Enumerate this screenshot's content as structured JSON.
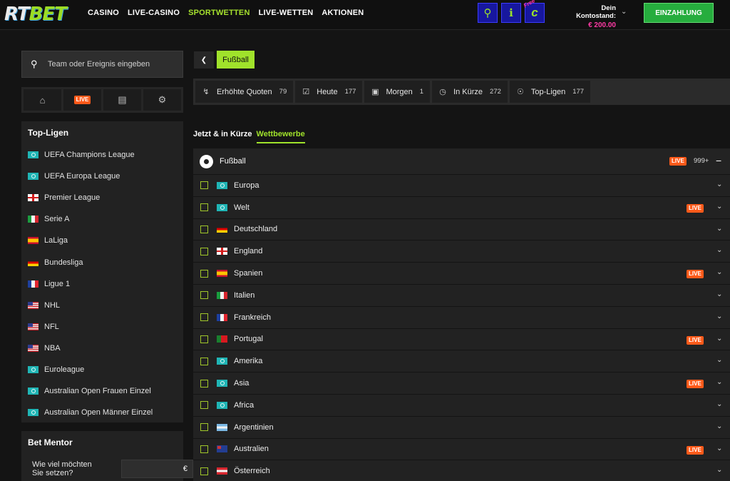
{
  "header": {
    "logo_a": "RT",
    "logo_b": "BET",
    "nav": [
      "CASINO",
      "LIVE-CASINO",
      "SPORTWETTEN",
      "LIVE-WETTEN",
      "AKTIONEN"
    ],
    "free_tag": "Free",
    "balance_label": "Dein Kontostand:",
    "balance_value": "€ 200.00",
    "deposit_label": "EINZAHLUNG"
  },
  "sidebar": {
    "search_placeholder": "Team oder Ereignis eingeben",
    "live_label": "LIVE",
    "top_leagues_title": "Top-Ligen",
    "leagues": [
      {
        "name": "UEFA Champions League",
        "flag": "world"
      },
      {
        "name": "UEFA Europa League",
        "flag": "world"
      },
      {
        "name": "Premier League",
        "flag": "eng"
      },
      {
        "name": "Serie A",
        "flag": "it"
      },
      {
        "name": "LaLiga",
        "flag": "es"
      },
      {
        "name": "Bundesliga",
        "flag": "de"
      },
      {
        "name": "Ligue 1",
        "flag": "fr"
      },
      {
        "name": "NHL",
        "flag": "us"
      },
      {
        "name": "NFL",
        "flag": "us"
      },
      {
        "name": "NBA",
        "flag": "us"
      },
      {
        "name": "Euroleague",
        "flag": "world"
      },
      {
        "name": "Australian Open Frauen Einzel",
        "flag": "world"
      },
      {
        "name": "Australian Open Männer Einzel",
        "flag": "world"
      }
    ],
    "bet_mentor_title": "Bet Mentor",
    "bet_mentor_question": "Wie viel möchten Sie setzen?",
    "bet_mentor_currency": "€"
  },
  "main": {
    "breadcrumb_sport": "Fußball",
    "filters": [
      {
        "label": "Erhöhte Quoten",
        "count": "79",
        "icon": "bolt-icon"
      },
      {
        "label": "Heute",
        "count": "177",
        "icon": "calendar-check-icon"
      },
      {
        "label": "Morgen",
        "count": "1",
        "icon": "calendar-icon"
      },
      {
        "label": "In Kürze",
        "count": "272",
        "icon": "clock-icon"
      },
      {
        "label": "Top-Ligen",
        "count": "177",
        "icon": "trophy-icon"
      }
    ],
    "tabs": [
      {
        "label": "Jetzt & in Kürze",
        "active": false
      },
      {
        "label": "Wettbewerbe",
        "active": true
      }
    ],
    "sport_header": {
      "name": "Fußball",
      "live": "LIVE",
      "count": "999+"
    },
    "countries": [
      {
        "name": "Europa",
        "flag": "world",
        "live": false
      },
      {
        "name": "Welt",
        "flag": "world",
        "live": true
      },
      {
        "name": "Deutschland",
        "flag": "de",
        "live": false
      },
      {
        "name": "England",
        "flag": "eng",
        "live": false
      },
      {
        "name": "Spanien",
        "flag": "es",
        "live": true
      },
      {
        "name": "Italien",
        "flag": "it",
        "live": false
      },
      {
        "name": "Frankreich",
        "flag": "fr",
        "live": false
      },
      {
        "name": "Portugal",
        "flag": "pt",
        "live": true
      },
      {
        "name": "Amerika",
        "flag": "world",
        "live": false
      },
      {
        "name": "Asia",
        "flag": "world",
        "live": true
      },
      {
        "name": "Africa",
        "flag": "world",
        "live": false
      },
      {
        "name": "Argentinien",
        "flag": "ar",
        "live": false
      },
      {
        "name": "Australien",
        "flag": "au",
        "live": true
      },
      {
        "name": "Österreich",
        "flag": "at",
        "live": false
      }
    ]
  },
  "colors": {
    "accent": "#a0e22b",
    "live": "#ff5a1a",
    "balance": "#ff3aa5",
    "deposit": "#26ad3e"
  }
}
